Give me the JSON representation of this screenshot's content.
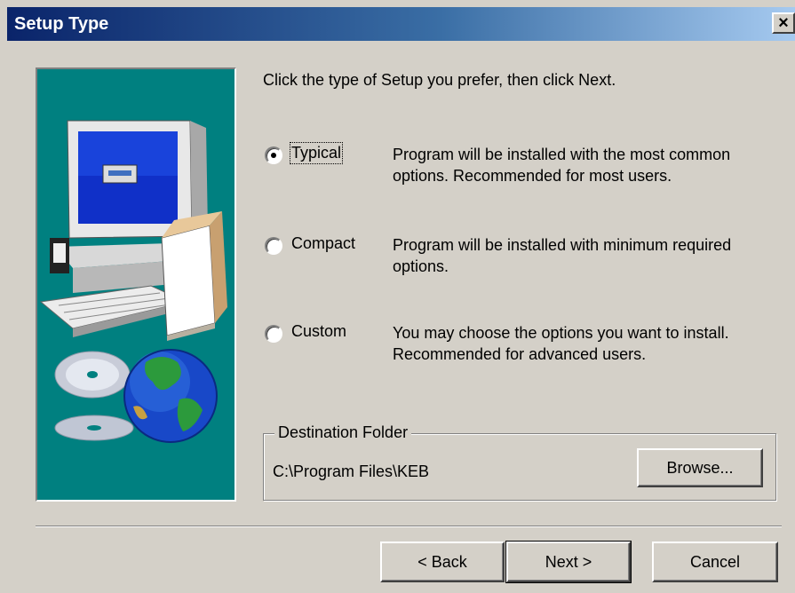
{
  "window": {
    "title": "Setup Type",
    "close_glyph": "×"
  },
  "instructions": "Click the type of Setup you prefer, then click Next.",
  "options": [
    {
      "label": "Typical",
      "description": [
        "Program will be installed with the most common",
        "options. Recommended for most users."
      ],
      "selected": true
    },
    {
      "label": "Compact",
      "description": [
        "Program will be installed with minimum required",
        "options."
      ],
      "selected": false
    },
    {
      "label": "Custom",
      "description": [
        "You may choose the options you want to install.",
        "Recommended for advanced users."
      ],
      "selected": false
    }
  ],
  "destination": {
    "legend": "Destination Folder",
    "path": "C:\\Program Files\\KEB",
    "browse_label": "Browse..."
  },
  "buttons": {
    "back": "< Back",
    "next": "Next >",
    "cancel": "Cancel"
  },
  "colors": {
    "illustration_bg": "#008080",
    "title_bar_start": "#0a246a",
    "dialog_bg": "#d4d0c8"
  },
  "illustration": {
    "icons": [
      "computer-icon",
      "box-icon",
      "cd-icon",
      "globe-icon"
    ]
  }
}
